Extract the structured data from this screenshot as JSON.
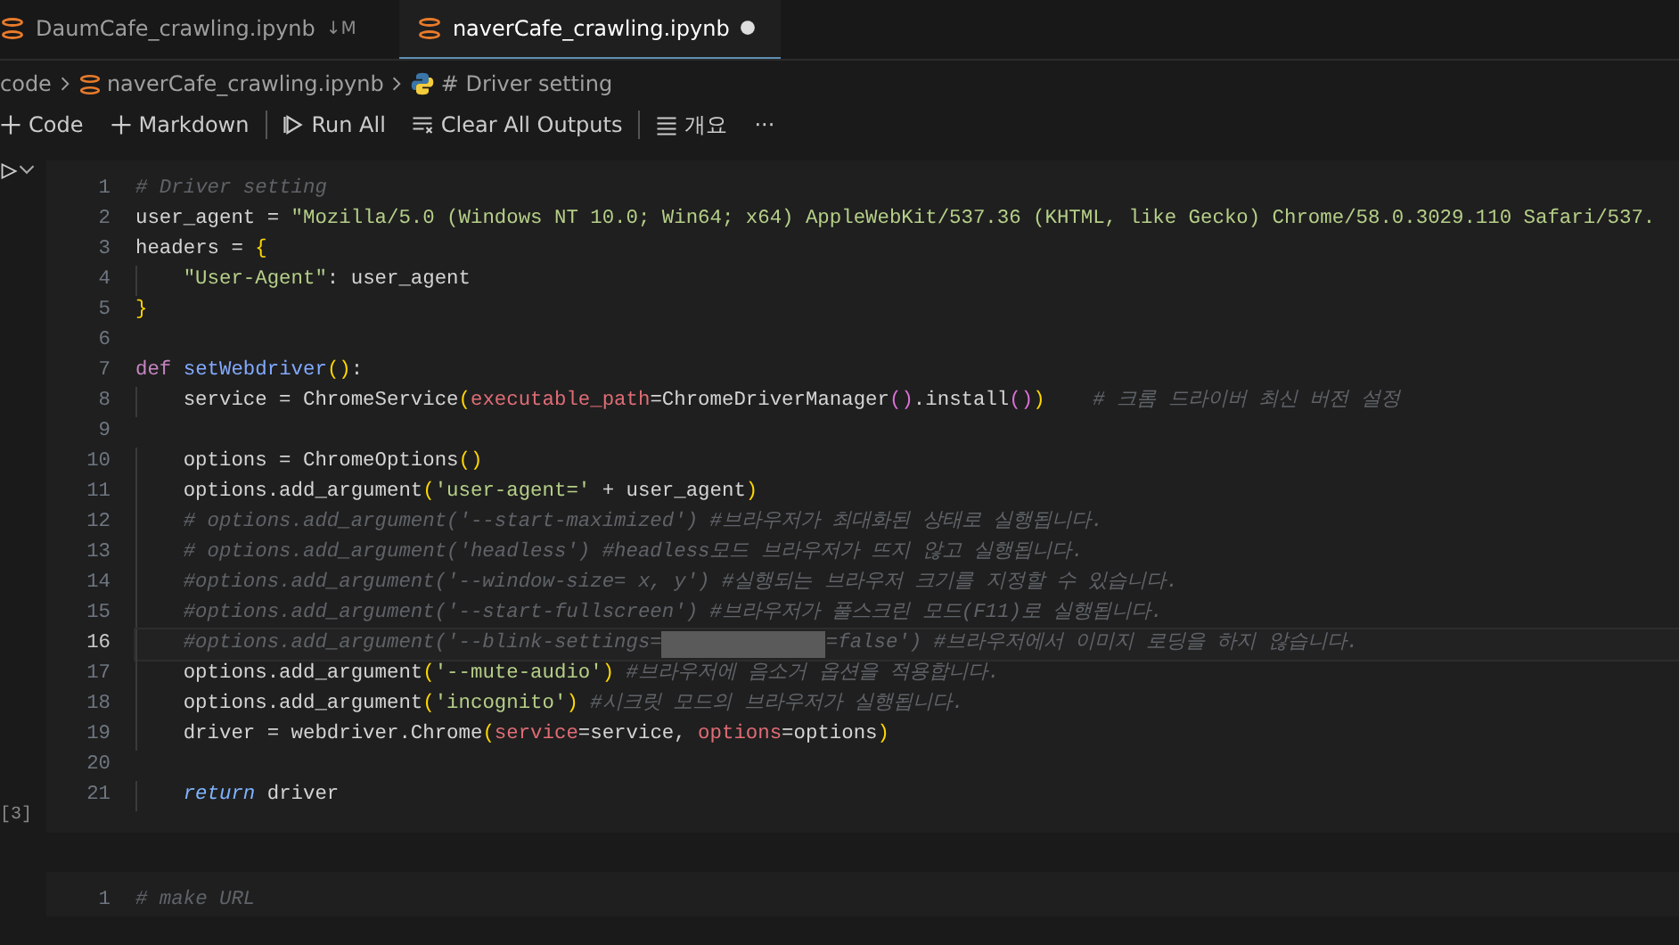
{
  "tabs": [
    {
      "label": "DaumCafe_crawling.ipynb",
      "status": "↓M",
      "selected": false,
      "dirty": false
    },
    {
      "label": "naverCafe_crawling.ipynb",
      "selected": true,
      "dirty": true
    }
  ],
  "breadcrumb": [
    "code",
    "naverCafe_crawling.ipynb",
    "# Driver setting"
  ],
  "toolbar": [
    {
      "kind": "plus",
      "label": "Code"
    },
    {
      "kind": "plus",
      "label": "Markdown"
    },
    {
      "kind": "sep"
    },
    {
      "kind": "run",
      "label": "Run All"
    },
    {
      "kind": "clear",
      "label": "Clear All Outputs"
    },
    {
      "kind": "sep"
    },
    {
      "kind": "outline",
      "label": "개요"
    },
    {
      "kind": "more",
      "label": "···"
    }
  ],
  "cells": [
    {
      "execution_count": "[3]",
      "lines": [
        {
          "number": "1",
          "current": false,
          "indented": false,
          "tokens": [
            {
              "kind": "comment",
              "text": "# Driver setting"
            }
          ]
        },
        {
          "number": "2",
          "current": false,
          "indented": false,
          "tokens": [
            {
              "kind": "plain",
              "text": "user_agent = "
            },
            {
              "kind": "str",
              "text": "\"Mozilla/5.0 (Windows NT 10.0; Win64; x64) AppleWebKit/537.36 (KHTML, like Gecko) Chrome/58.0.3029.110 Safari/537."
            }
          ]
        },
        {
          "number": "3",
          "current": false,
          "indented": false,
          "tokens": [
            {
              "kind": "plain",
              "text": "headers = "
            },
            {
              "kind": "paren1",
              "text": "{"
            }
          ]
        },
        {
          "number": "4",
          "current": false,
          "indented": true,
          "tokens": [
            {
              "kind": "str",
              "text": "\"User-Agent\""
            },
            {
              "kind": "plain",
              "text": ": user_agent"
            }
          ]
        },
        {
          "number": "5",
          "current": false,
          "indented": false,
          "tokens": [
            {
              "kind": "paren1",
              "text": "}"
            }
          ]
        },
        {
          "number": "6",
          "current": false,
          "indented": false
        },
        {
          "number": "7",
          "current": false,
          "indented": false,
          "tokens": [
            {
              "kind": "keyword",
              "text": "def "
            },
            {
              "kind": "fn",
              "text": "setWebdriver"
            },
            {
              "kind": "paren1",
              "text": "()"
            },
            {
              "kind": "plain",
              "text": ":"
            }
          ]
        },
        {
          "number": "8",
          "current": false,
          "indented": true,
          "tokens": [
            {
              "kind": "plain",
              "text": "service = ChromeService"
            },
            {
              "kind": "paren1",
              "text": "("
            },
            {
              "kind": "param",
              "text": "executable_path"
            },
            {
              "kind": "plain",
              "text": "=ChromeDriverManager"
            },
            {
              "kind": "paren2",
              "text": "()"
            },
            {
              "kind": "plain",
              "text": ".install"
            },
            {
              "kind": "paren2",
              "text": "()"
            },
            {
              "kind": "paren1",
              "text": ")    "
            },
            {
              "kind": "comment",
              "text": "# 크롬 드라이버 최신 버전 설정"
            }
          ]
        },
        {
          "number": "9",
          "current": false,
          "indented": false
        },
        {
          "number": "10",
          "current": false,
          "indented": true,
          "tokens": [
            {
              "kind": "plain",
              "text": "options = ChromeOptions"
            },
            {
              "kind": "paren1",
              "text": "()"
            }
          ]
        },
        {
          "number": "11",
          "current": false,
          "indented": true,
          "tokens": [
            {
              "kind": "plain",
              "text": "options.add_argument"
            },
            {
              "kind": "paren1",
              "text": "("
            },
            {
              "kind": "str",
              "text": "'user-agent='"
            },
            {
              "kind": "plain",
              "text": " + user_agent"
            },
            {
              "kind": "paren1",
              "text": ")"
            }
          ]
        },
        {
          "number": "12",
          "current": false,
          "indented": true,
          "tokens": [
            {
              "kind": "comment",
              "text": "# options.add_argument('--start-maximized') #브라우저가 최대화된 상태로 실행됩니다."
            }
          ]
        },
        {
          "number": "13",
          "current": false,
          "indented": true,
          "tokens": [
            {
              "kind": "comment",
              "text": "# options.add_argument('headless') #headless모드 브라우저가 뜨지 않고 실행됩니다."
            }
          ]
        },
        {
          "number": "14",
          "current": false,
          "indented": true,
          "tokens": [
            {
              "kind": "comment",
              "text": "#options.add_argument('--window-size= x, y') #실행되는 브라우저 크기를 지정할 수 있습니다."
            }
          ]
        },
        {
          "number": "15",
          "current": false,
          "indented": true,
          "tokens": [
            {
              "kind": "comment",
              "text": "#options.add_argument('--start-fullscreen') #브라우저가 풀스크린 모드(F11)로 실행됩니다."
            }
          ]
        },
        {
          "number": "16",
          "current": true,
          "indented": true,
          "tokens": [
            {
              "kind": "comment",
              "text": "#options.add_argument('--blink-settings="
            },
            {
              "kind": "masked"
            },
            {
              "kind": "comment",
              "text": "=false') #브라우저에서 이미지 로딩을 하지 않습니다."
            }
          ]
        },
        {
          "number": "17",
          "current": false,
          "indented": true,
          "tokens": [
            {
              "kind": "plain",
              "text": "options.add_argument"
            },
            {
              "kind": "paren1",
              "text": "("
            },
            {
              "kind": "str",
              "text": "'--mute-audio'"
            },
            {
              "kind": "paren1",
              "text": ") "
            },
            {
              "kind": "comment",
              "text": "#브라우저에 음소거 옵션을 적용합니다."
            }
          ]
        },
        {
          "number": "18",
          "current": false,
          "indented": true,
          "tokens": [
            {
              "kind": "plain",
              "text": "options.add_argument"
            },
            {
              "kind": "paren1",
              "text": "("
            },
            {
              "kind": "str",
              "text": "'incognito'"
            },
            {
              "kind": "paren1",
              "text": ") "
            },
            {
              "kind": "comment",
              "text": "#시크릿 모드의 브라우저가 실행됩니다."
            }
          ]
        },
        {
          "number": "19",
          "current": false,
          "indented": true,
          "tokens": [
            {
              "kind": "plain",
              "text": "driver = webdriver.Chrome"
            },
            {
              "kind": "paren1",
              "text": "("
            },
            {
              "kind": "param",
              "text": "service"
            },
            {
              "kind": "plain",
              "text": "=service, "
            },
            {
              "kind": "param",
              "text": "options"
            },
            {
              "kind": "plain",
              "text": "=options"
            },
            {
              "kind": "paren1",
              "text": ")"
            }
          ]
        },
        {
          "number": "20",
          "current": false,
          "indented": false
        },
        {
          "number": "21",
          "current": false,
          "indented": true,
          "tokens": [
            {
              "kind": "ctrl",
              "text": "return"
            },
            {
              "kind": "plain",
              "text": " driver"
            }
          ]
        }
      ]
    },
    {
      "lines": [
        {
          "number": "1",
          "current": false,
          "indented": false,
          "tokens": [
            {
              "kind": "comment",
              "text": "# make URL"
            }
          ]
        }
      ]
    }
  ]
}
